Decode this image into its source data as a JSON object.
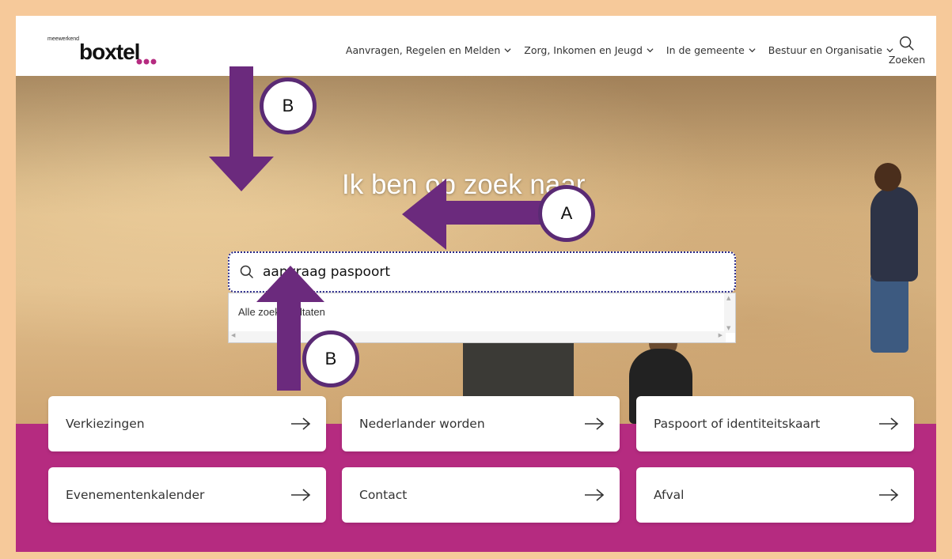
{
  "header": {
    "logo_small": "meewerkend",
    "logo_main": "boxtel",
    "nav": [
      {
        "label": "Aanvragen, Regelen en Melden"
      },
      {
        "label": "Zorg, Inkomen en Jeugd"
      },
      {
        "label": "In de gemeente"
      },
      {
        "label": "Bestuur en Organisatie"
      }
    ],
    "search_label": "Zoeken",
    "search_icon": "search-icon"
  },
  "hero": {
    "title": "Ik ben op zoek naar",
    "search_value": "aanvraag paspoort",
    "dropdown_item": "Alle zoekresultaten"
  },
  "markers": {
    "a": "A",
    "b_top": "B",
    "b_bottom": "B"
  },
  "tiles": [
    {
      "label": "Verkiezingen"
    },
    {
      "label": "Nederlander worden"
    },
    {
      "label": "Paspoort of identiteitskaart"
    },
    {
      "label": "Evenementenkalender"
    },
    {
      "label": "Contact"
    },
    {
      "label": "Afval"
    }
  ],
  "colors": {
    "frame": "#f6c99a",
    "brand_pink": "#b52b80",
    "annotation_purple": "#6b2a7d"
  }
}
